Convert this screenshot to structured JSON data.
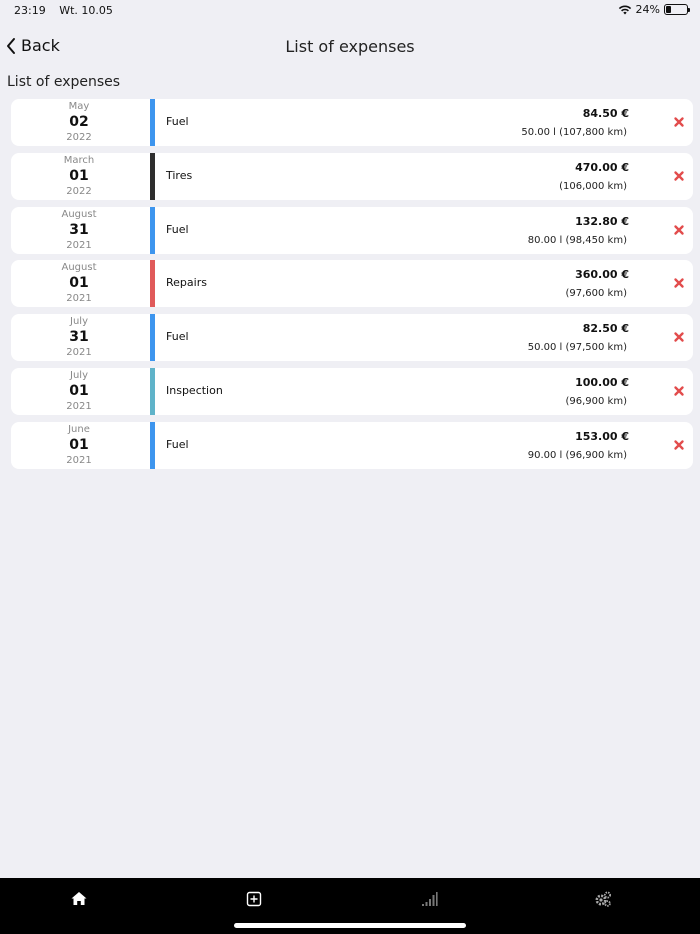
{
  "status_bar": {
    "time": "23:19",
    "date": "Wt. 10.05",
    "battery": "24%",
    "battery_level": 0.24
  },
  "nav": {
    "back_label": "Back",
    "title": "List of expenses"
  },
  "section_title": "List of expenses",
  "expenses": [
    {
      "month": "May",
      "day": "02",
      "year": "2022",
      "category": "Fuel",
      "color": "#3d95ee",
      "amount": "84.50 €",
      "details": "50.00 l  (107,800 km)"
    },
    {
      "month": "March",
      "day": "01",
      "year": "2022",
      "category": "Tires",
      "color": "#2e2e2e",
      "amount": "470.00 €",
      "details": "(106,000 km)"
    },
    {
      "month": "August",
      "day": "31",
      "year": "2021",
      "category": "Fuel",
      "color": "#3d95ee",
      "amount": "132.80 €",
      "details": "80.00 l  (98,450 km)"
    },
    {
      "month": "August",
      "day": "01",
      "year": "2021",
      "category": "Repairs",
      "color": "#e05a5a",
      "amount": "360.00 €",
      "details": "(97,600 km)"
    },
    {
      "month": "July",
      "day": "31",
      "year": "2021",
      "category": "Fuel",
      "color": "#3d95ee",
      "amount": "82.50 €",
      "details": "50.00 l  (97,500 km)"
    },
    {
      "month": "July",
      "day": "01",
      "year": "2021",
      "category": "Inspection",
      "color": "#5fb3c9",
      "amount": "100.00 €",
      "details": "(96,900 km)"
    },
    {
      "month": "June",
      "day": "01",
      "year": "2021",
      "category": "Fuel",
      "color": "#3d95ee",
      "amount": "153.00 €",
      "details": "90.00 l  (96,900 km)"
    }
  ],
  "delete_color": "#e24c4c",
  "tabs": [
    {
      "icon": "home-icon"
    },
    {
      "icon": "add-square-icon"
    },
    {
      "icon": "signal-bars-icon"
    },
    {
      "icon": "gears-icon"
    }
  ]
}
